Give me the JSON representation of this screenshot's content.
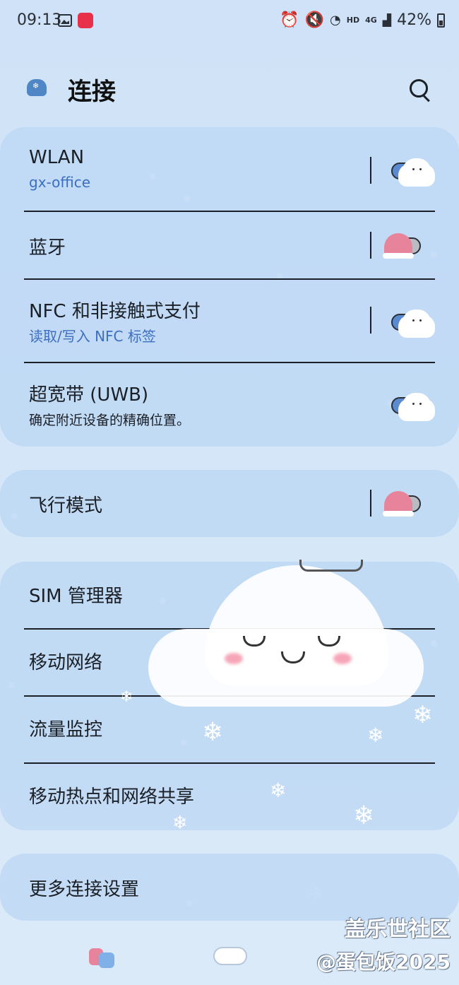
{
  "status_bar": {
    "time": "09:13",
    "hd_label": "HD",
    "network_label": "4G",
    "battery": "42%",
    "icons": [
      "photo-icon",
      "xiaohongshu-app-icon",
      "alarm-icon",
      "mute-icon",
      "wifi-icon",
      "signal-icon",
      "battery-icon"
    ]
  },
  "header": {
    "title": "连接",
    "search_icon": "search-icon"
  },
  "connections": [
    {
      "title": "WLAN",
      "subtitle": "gx-office",
      "toggle": "on"
    },
    {
      "title": "蓝牙",
      "subtitle": "",
      "toggle": "off"
    },
    {
      "title": "NFC 和非接触式支付",
      "subtitle": "读取/写入 NFC 标签",
      "toggle": "on"
    },
    {
      "title": "超宽带 (UWB)",
      "subtitle": "确定附近设备的精确位置。",
      "toggle": "on"
    }
  ],
  "airplane": {
    "title": "飞行模式",
    "toggle": "off"
  },
  "sim_group": [
    "SIM 管理器",
    "移动网络",
    "流量监控",
    "移动热点和网络共享"
  ],
  "more": {
    "title": "更多连接设置"
  },
  "watermark": {
    "line1": "盖乐世社区",
    "line2": "@蛋包饭2025"
  },
  "colors": {
    "accent": "#3c6fc0",
    "toggle_on": "#5a8ad0",
    "toggle_off": "#b9bcc2",
    "hat_pink": "#e7839a"
  }
}
